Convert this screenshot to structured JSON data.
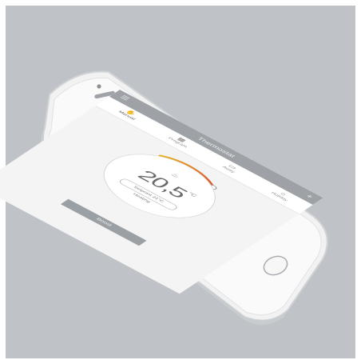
{
  "header": {
    "title": "Thermostat",
    "menu_icon": "menu-icon",
    "add_icon": "plus-icon"
  },
  "modes": [
    {
      "label": "Manual",
      "icon": "hand-icon"
    },
    {
      "label": "Program",
      "icon": "calendar-icon"
    },
    {
      "label": "Away",
      "icon": "suitcase-icon"
    },
    {
      "label": "Holiday",
      "icon": "sun-icon"
    }
  ],
  "dial": {
    "temperature": "20,5",
    "unit": "°C",
    "setpoint": "Setpoint 21°C",
    "status": "Heating",
    "flame_icon": "flame-icon"
  },
  "footer": {
    "button_label": "Boost"
  },
  "colors": {
    "accent_start": "#e8b321",
    "accent_end": "#d9502a",
    "bar": "#9ea2a6"
  }
}
